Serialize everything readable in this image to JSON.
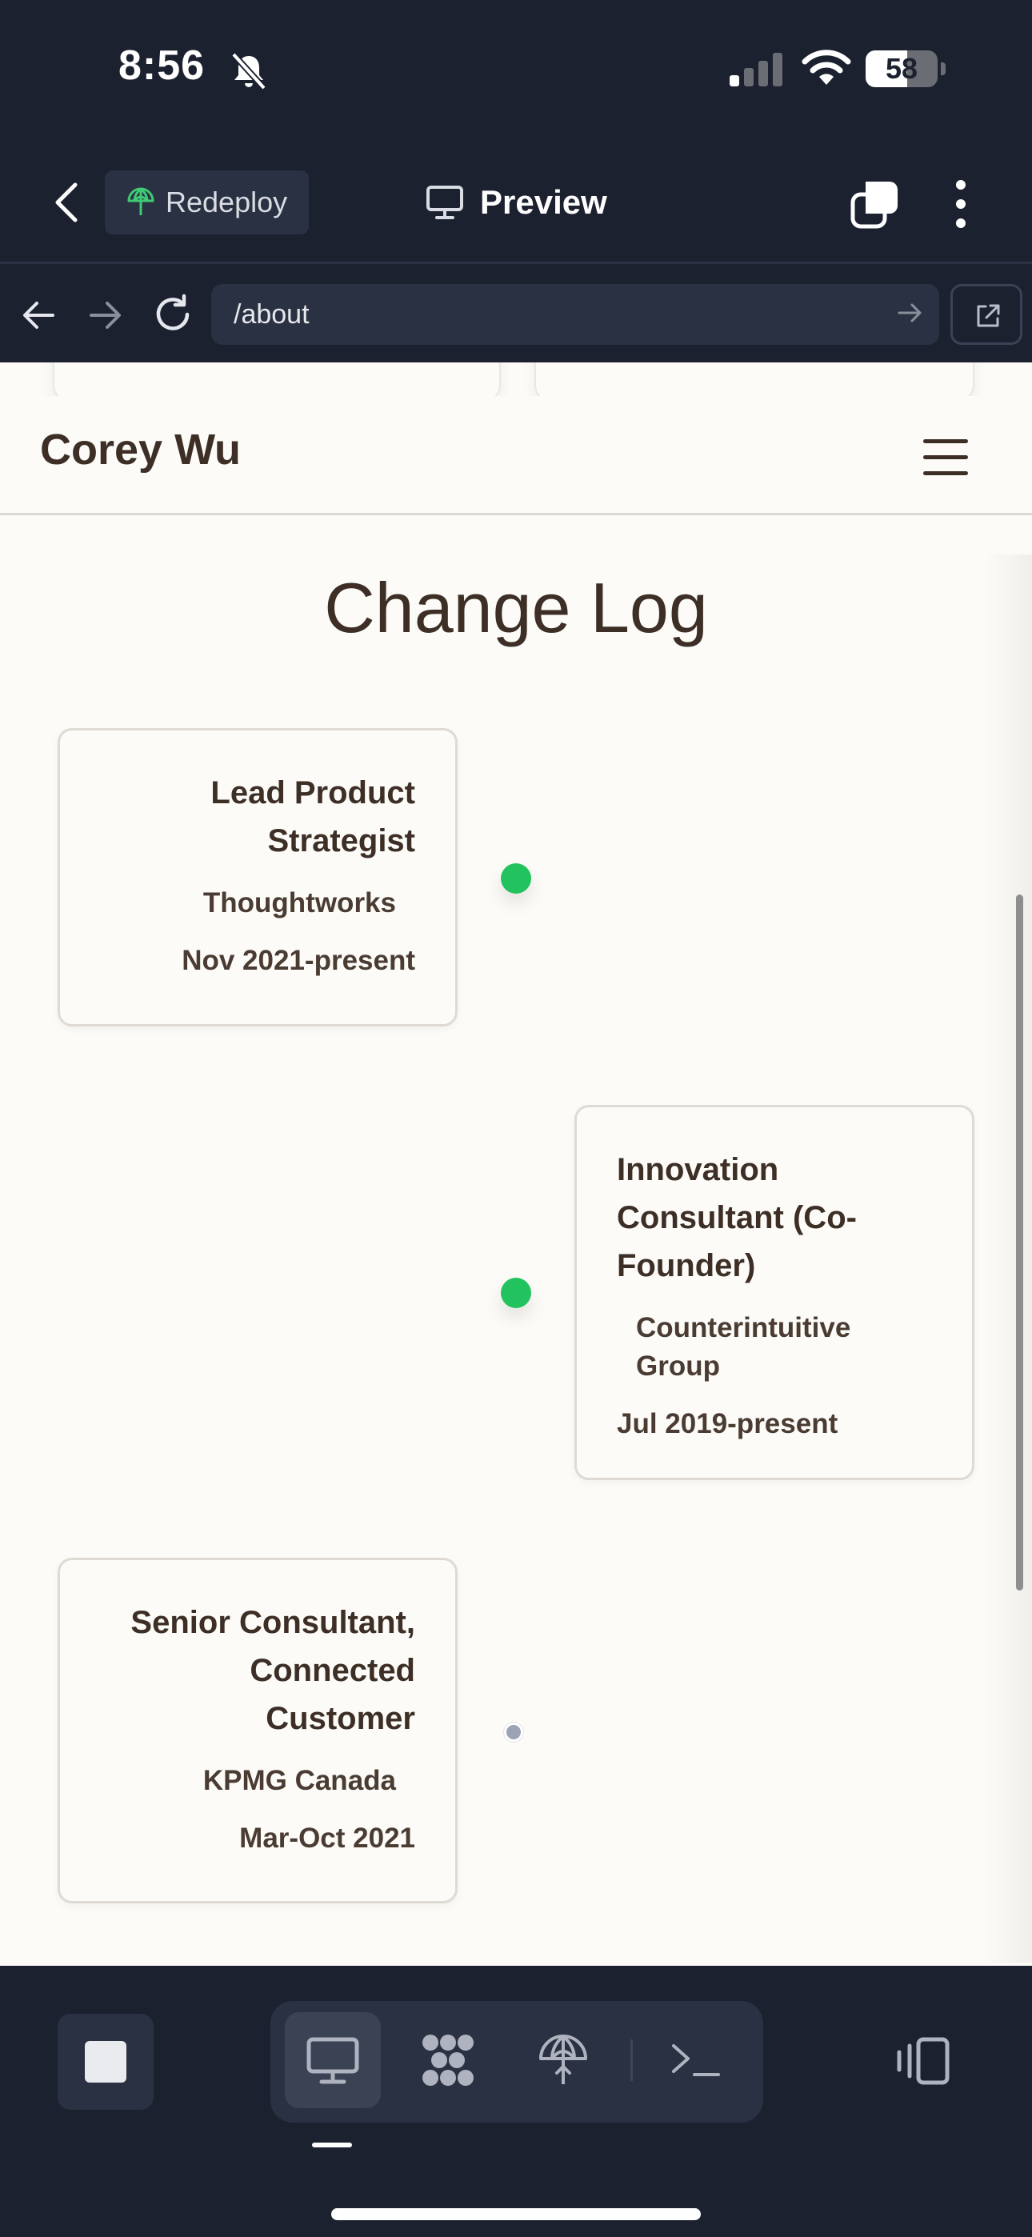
{
  "status_bar": {
    "time": "8:56",
    "battery_level": "58",
    "battery_fraction": 0.58,
    "icons": [
      "bell-slash-icon",
      "cellular-signal-icon",
      "wifi-icon",
      "battery-icon"
    ]
  },
  "toolbar": {
    "redeploy_label": "Redeploy",
    "preview_label": "Preview",
    "icons": [
      "chevron-left-icon",
      "deploy-icon",
      "monitor-icon",
      "tabs-icon",
      "more-vertical-icon"
    ]
  },
  "browser": {
    "url": "/about",
    "icons": [
      "arrow-left-icon",
      "arrow-right-icon",
      "reload-icon",
      "go-arrow-icon",
      "open-external-icon"
    ]
  },
  "site": {
    "title": "Corey Wu",
    "menu_icon": "hamburger-menu-icon"
  },
  "changelog": {
    "heading": "Change Log",
    "entries": [
      {
        "role": "Lead Product Strategist",
        "company": "Thoughtworks",
        "dates": "Nov 2021-present",
        "status": "active",
        "side": "left"
      },
      {
        "role": "Innovation Consultant (Co-Founder)",
        "company": "Counterintuitive Group",
        "dates": "Jul 2019-present",
        "status": "active",
        "side": "right"
      },
      {
        "role": "Senior Consultant, Connected Customer",
        "company": "KPMG Canada",
        "dates": "Mar-Oct 2021",
        "status": "inactive",
        "side": "left"
      }
    ]
  },
  "dock": {
    "icons": [
      "stop-icon",
      "desktop-icon",
      "nodes-icon",
      "deploy-icon",
      "terminal-icon",
      "layout-toggle-icon"
    ],
    "active_tool": "desktop"
  },
  "colors": {
    "chrome_bg": "#1c2130",
    "chrome_surface": "#2a3142",
    "page_bg": "#fcfbf7",
    "text_brown": "#3d2f26",
    "active_dot": "#22c35e",
    "inactive_dot": "#9ba3b4"
  }
}
